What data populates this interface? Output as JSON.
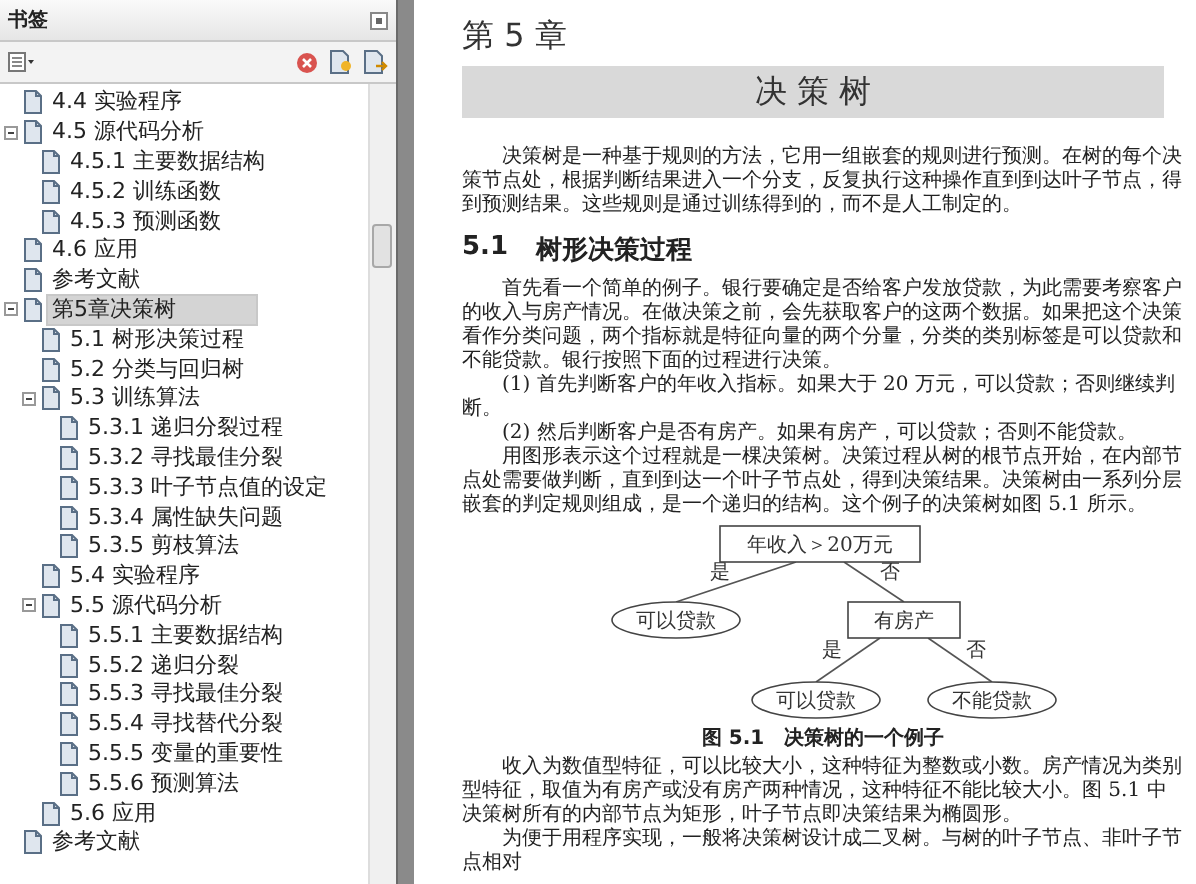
{
  "bookmarks_panel": {
    "title": "书签",
    "tree": [
      {
        "children": [
          {
            "label": "4.4 实验程序",
            "selected": false
          },
          {
            "label": "4.5 源代码分析",
            "expanded": true,
            "selected": false,
            "children": [
              {
                "label": "4.5.1 主要数据结构",
                "selected": false
              },
              {
                "label": "4.5.2 训练函数",
                "selected": false
              },
              {
                "label": "4.5.3 预测函数",
                "selected": false
              }
            ]
          },
          {
            "label": "4.6 应用",
            "selected": false
          }
        ]
      },
      {
        "label": "参考文献",
        "selected": false
      },
      {
        "label": "第5章决策树",
        "expanded": true,
        "selected": true,
        "children": [
          {
            "label": "5.1 树形决策过程",
            "selected": false
          },
          {
            "label": "5.2 分类与回归树",
            "selected": false
          },
          {
            "label": "5.3 训练算法",
            "expanded": true,
            "selected": false,
            "children": [
              {
                "label": "5.3.1 递归分裂过程",
                "selected": false
              },
              {
                "label": "5.3.2 寻找最佳分裂",
                "selected": false
              },
              {
                "label": "5.3.3 叶子节点值的设定",
                "selected": false
              },
              {
                "label": "5.3.4 属性缺失问题",
                "selected": false
              },
              {
                "label": "5.3.5 剪枝算法",
                "selected": false
              }
            ]
          },
          {
            "label": "5.4 实验程序",
            "selected": false
          },
          {
            "label": "5.5 源代码分析",
            "expanded": true,
            "selected": false,
            "children": [
              {
                "label": "5.5.1 主要数据结构",
                "selected": false
              },
              {
                "label": "5.5.2 递归分裂",
                "selected": false
              },
              {
                "label": "5.5.3 寻找最佳分裂",
                "selected": false
              },
              {
                "label": "5.5.4 寻找替代分裂",
                "selected": false
              },
              {
                "label": "5.5.5 变量的重要性",
                "selected": false
              },
              {
                "label": "5.5.6 预测算法",
                "selected": false
              }
            ]
          },
          {
            "label": "5.6 应用",
            "selected": false
          }
        ]
      },
      {
        "label": "参考文献",
        "selected": false
      }
    ]
  },
  "page": {
    "chapter_label": "第 5 章",
    "chapter_title": "决 策 树",
    "body": [
      {
        "kind": "paragraph",
        "text": "决策树是一种基于规则的方法，它用一组嵌套的规则进行预测。在树的每个决策节点处，根据判断结果进入一个分支，反复执行这种操作直到到达叶子节点，得到预测结果。这些规则是通过训练得到的，而不是人工制定的。"
      },
      {
        "kind": "heading",
        "number": "5.1",
        "title": "树形决策过程"
      },
      {
        "kind": "paragraph",
        "text": "首先看一个简单的例子。银行要确定是否给客户发放贷款，为此需要考察客户的收入与房产情况。在做决策之前，会先获取客户的这两个数据。如果把这个决策看作分类问题，两个指标就是特征向量的两个分量，分类的类别标签是可以贷款和不能贷款。银行按照下面的过程进行决策。"
      },
      {
        "kind": "paragraph",
        "text": "(1) 首先判断客户的年收入指标。如果大于 20 万元，可以贷款；否则继续判断。"
      },
      {
        "kind": "paragraph",
        "text": "(2) 然后判断客户是否有房产。如果有房产，可以贷款；否则不能贷款。"
      },
      {
        "kind": "paragraph",
        "text": "用图形表示这个过程就是一棵决策树。决策过程从树的根节点开始，在内部节点处需要做判断，直到到达一个叶子节点处，得到决策结果。决策树由一系列分层嵌套的判定规则组成，是一个递归的结构。这个例子的决策树如图 5.1 所示。"
      },
      {
        "kind": "figure",
        "nodes": [
          {
            "kind": "decision",
            "label": "年收入＞20万元"
          },
          {
            "kind": "leaf",
            "label": "可以贷款"
          },
          {
            "kind": "decision",
            "label": "有房产"
          },
          {
            "kind": "leaf",
            "label": "可以贷款"
          },
          {
            "kind": "leaf",
            "label": "不能贷款"
          }
        ],
        "edges": [
          {
            "label": "是"
          },
          {
            "label": "否"
          },
          {
            "label": "是"
          },
          {
            "label": "否"
          }
        ],
        "caption": "图 5.1　决策树的一个例子"
      },
      {
        "kind": "paragraph",
        "text": "收入为数值型特征，可以比较大小，这种特征为整数或小数。房产情况为类别型特征，取值为有房产或没有房产两种情况，这种特征不能比较大小。图 5.1 中决策树所有的内部节点为矩形，叶子节点即决策结果为椭圆形。"
      },
      {
        "kind": "paragraph",
        "text": "为便于用程序实现，一般将决策树设计成二叉树。与树的叶子节点、非叶子节点相对"
      }
    ]
  }
}
